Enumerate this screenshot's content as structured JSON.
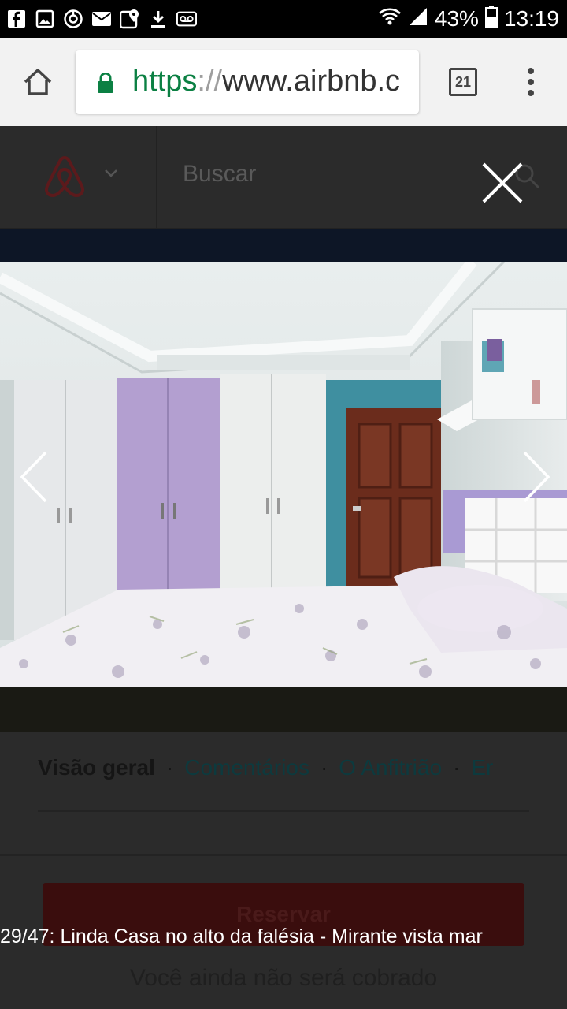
{
  "status_bar": {
    "battery": "43%",
    "time": "13:19",
    "left_icons": [
      "facebook-icon",
      "gallery-icon",
      "sync-icon",
      "mail-icon",
      "maps-icon",
      "download-icon",
      "voicemail-icon"
    ]
  },
  "browser": {
    "url_scheme": "https",
    "url_sep": "://",
    "url_host": "www.airbnb.c",
    "tab_count": "21"
  },
  "site_header": {
    "search_placeholder": "Buscar"
  },
  "gallery": {
    "caption": "29/47: Linda Casa no alto da falésia - Mirante vista mar"
  },
  "subnav": {
    "items": [
      "Visão geral",
      "Comentários",
      "O Anfitrião",
      "Er"
    ]
  },
  "booking": {
    "reserve_label": "Reservar",
    "no_charge_text": "Você ainda não será cobrado"
  },
  "colors": {
    "url_green": "#0b8043",
    "brand": "#ff5a5f"
  }
}
